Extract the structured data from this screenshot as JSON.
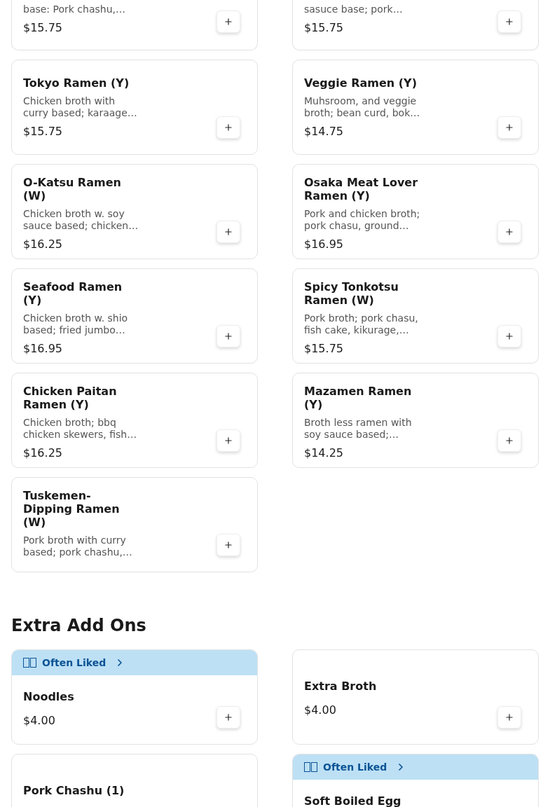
{
  "menu_items": [
    {
      "cut_top": true,
      "description": "base: Pork chashu,…",
      "price": "$15.75"
    },
    {
      "cut_top": true,
      "description": "sasuce base; pork…",
      "price": "$15.75"
    },
    {
      "name": "Tokyo Ramen (Y)",
      "description": "Chicken broth with curry based; karaage…",
      "price": "$15.75"
    },
    {
      "name": "Veggie Ramen (Y)",
      "description": "Muhsroom, and veggie broth; bean curd, bok…",
      "price": "$14.75"
    },
    {
      "name": "O-Katsu Ramen (W)",
      "description": "Chicken broth w. soy sauce based; chicken…",
      "price": "$16.25"
    },
    {
      "name": "Osaka Meat Lover Ramen (Y)",
      "description": "Pork and chicken broth; pork chasu, ground…",
      "price": "$16.95"
    },
    {
      "name": "Seafood Ramen (Y)",
      "description": "Chicken broth w. shio based; fried jumbo…",
      "price": "$16.95"
    },
    {
      "name": "Spicy Tonkotsu Ramen (W)",
      "description": "Pork broth; pork chasu, fish cake, kikurage,…",
      "price": "$15.75"
    },
    {
      "name": "Chicken Paitan Ramen (Y)",
      "description": "Chicken broth; bbq chicken skewers, fish…",
      "price": "$16.25"
    },
    {
      "name": "Mazamen Ramen (Y)",
      "description": "Broth less ramen with soy sauce based;…",
      "price": "$14.25"
    },
    {
      "name": "Tuskemen-Dipping Ramen (W)",
      "description": "Pork broth with curry based; pork chashu,…"
    }
  ],
  "extra_section": {
    "title": "Extra Add Ons",
    "items": [
      {
        "banner": "Often Liked",
        "name": "Noodles",
        "price": "$4.00"
      },
      {
        "name": "Extra Broth",
        "price": "$4.00"
      },
      {
        "name": "Pork Chashu (1)"
      },
      {
        "banner": "Often Liked",
        "name": "Soft Boiled Egg"
      }
    ]
  }
}
